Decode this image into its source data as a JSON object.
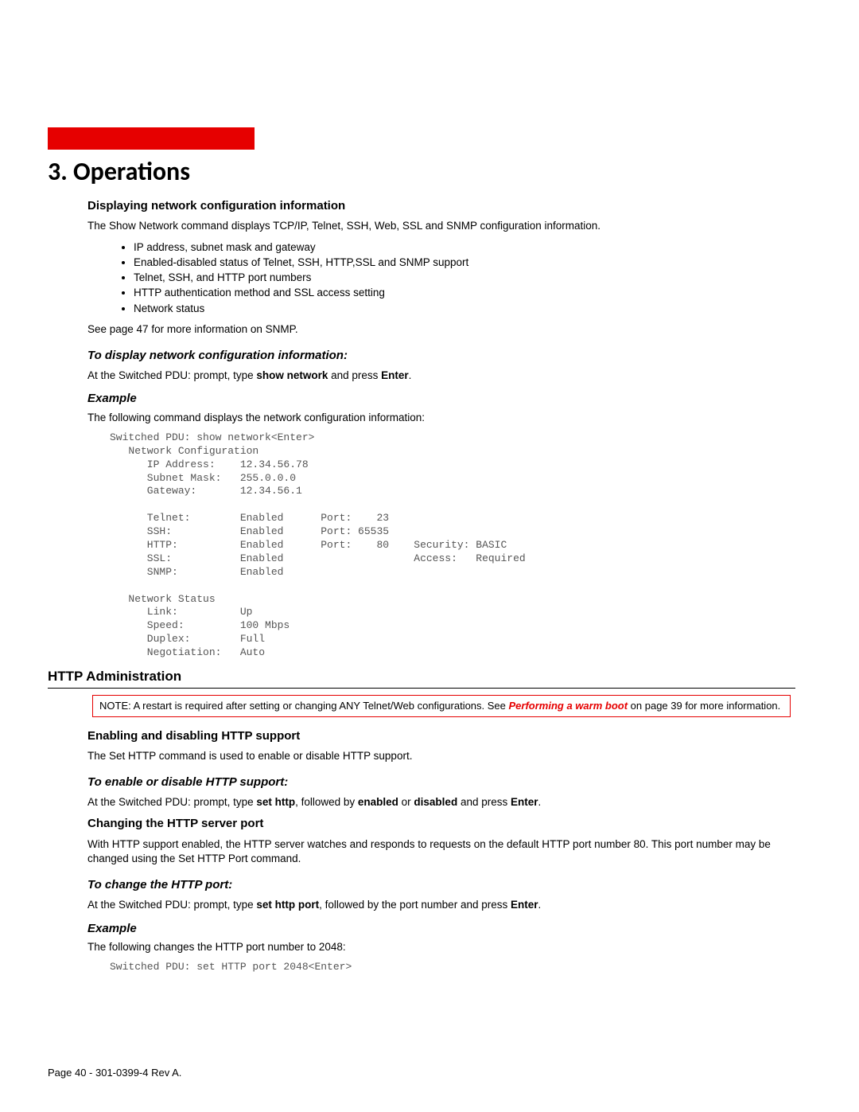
{
  "chapter": "3. Operations",
  "sec1": {
    "title": "Displaying network configuration information",
    "p1": "The Show Network command displays TCP/IP, Telnet, SSH, Web, SSL and SNMP configuration information.",
    "bullets": [
      "IP address, subnet mask and gateway",
      "Enabled-disabled status of Telnet, SSH, HTTP,SSL and SNMP support",
      "Telnet, SSH, and HTTP port numbers",
      "HTTP authentication method and SSL access setting",
      "Network status"
    ],
    "p2": "See page 47 for more information on SNMP.",
    "how_title": "To display network configuration information:",
    "how_p_pre": "At the Switched PDU: prompt, type ",
    "how_cmd": "show network",
    "how_mid": " and press ",
    "how_enter": "Enter",
    "how_end": ".",
    "ex_title": "Example",
    "ex_p": "The following command displays the network configuration information:",
    "console": "Switched PDU: show network<Enter>\n   Network Configuration\n      IP Address:    12.34.56.78\n      Subnet Mask:   255.0.0.0\n      Gateway:       12.34.56.1\n\n      Telnet:        Enabled      Port:    23\n      SSH:           Enabled      Port: 65535\n      HTTP:          Enabled      Port:    80    Security: BASIC\n      SSL:           Enabled                     Access:   Required\n      SNMP:          Enabled\n\n   Network Status\n      Link:          Up\n      Speed:         100 Mbps\n      Duplex:        Full\n      Negotiation:   Auto"
  },
  "sec2": {
    "title": "HTTP Administration",
    "note_pre": "NOTE:  A restart is required after setting or changing ANY Telnet/Web configurations.  See ",
    "note_em": "Performing a warm boot",
    "note_post": " on page 39 for more information.",
    "sub1": {
      "title": "Enabling and disabling HTTP support",
      "p": "The Set HTTP command is used to enable or disable HTTP support.",
      "how_title": "To enable or disable HTTP support:",
      "how_pre": "At the Switched PDU: prompt, type ",
      "cmd1": "set http",
      "mid1": ", followed by ",
      "cmd2": "enabled",
      "mid2": " or ",
      "cmd3": "disabled",
      "mid3": " and press ",
      "enter": "Enter",
      "end": "."
    },
    "sub2": {
      "title": "Changing the HTTP server port",
      "p": "With HTTP support enabled, the HTTP server watches and responds to requests on the default HTTP port number 80. This port number may be changed using the Set HTTP Port command.",
      "how_title": "To change the HTTP port:",
      "how_pre": "At the Switched PDU: prompt, type ",
      "cmd": "set http port",
      "mid": ", followed by the port number and press ",
      "enter": "Enter",
      "end": ".",
      "ex_title": "Example",
      "ex_p": "The following changes the HTTP port number to 2048:",
      "console": "Switched PDU: set HTTP port 2048<Enter>"
    }
  },
  "footer": "Page 40 - 301-0399-4 Rev A."
}
